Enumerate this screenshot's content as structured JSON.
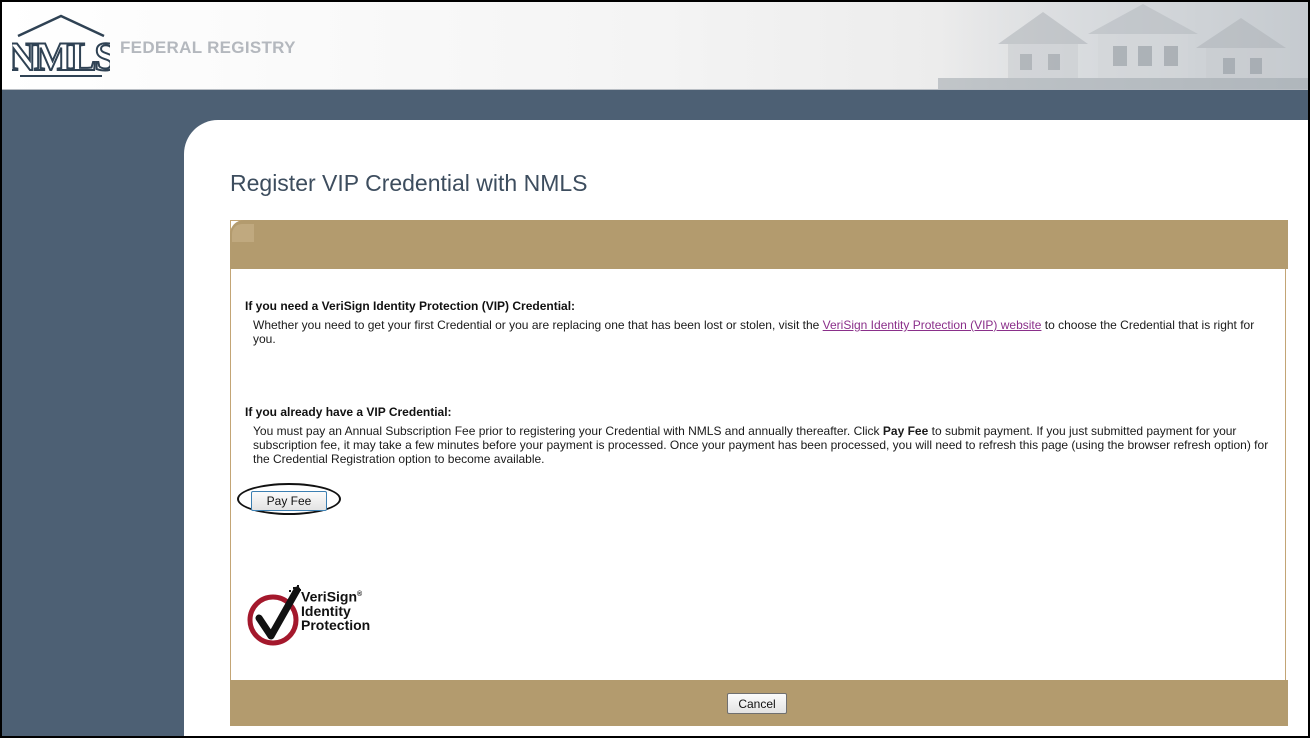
{
  "header": {
    "logo_text": "NMLS",
    "title": "FEDERAL REGISTRY"
  },
  "page": {
    "title": "Register VIP Credential with NMLS"
  },
  "section_need": {
    "heading": "If you need a VeriSign Identity Protection (VIP) Credential:",
    "text_before": "Whether you need to get your first Credential or you are replacing one that has been lost or stolen, visit the ",
    "link": "VeriSign Identity Protection (VIP) website",
    "text_after": " to choose the Credential that is right for you."
  },
  "section_have": {
    "heading": "If you already have a VIP Credential:",
    "text_before": "You must pay an Annual Subscription Fee prior to registering your Credential with NMLS and annually thereafter. Click ",
    "bold": "Pay Fee",
    "text_after": " to submit payment. If you just submitted payment for your subscription fee, it may take a few minutes before your payment is processed. Once your payment has been processed, you will need to refresh this page (using the browser refresh option) for the Credential Registration option to become available."
  },
  "buttons": {
    "pay_fee": "Pay Fee",
    "cancel": "Cancel"
  },
  "verisign_logo": {
    "line1": "VeriSign",
    "line2": "Identity",
    "line3": "Protection",
    "mark": "®"
  },
  "colors": {
    "sidebar": "#4d6074",
    "panel_band": "#b39b6e",
    "title_text": "#3d4d5e",
    "link": "#8a2f8a",
    "logo_red": "#a4182c"
  }
}
